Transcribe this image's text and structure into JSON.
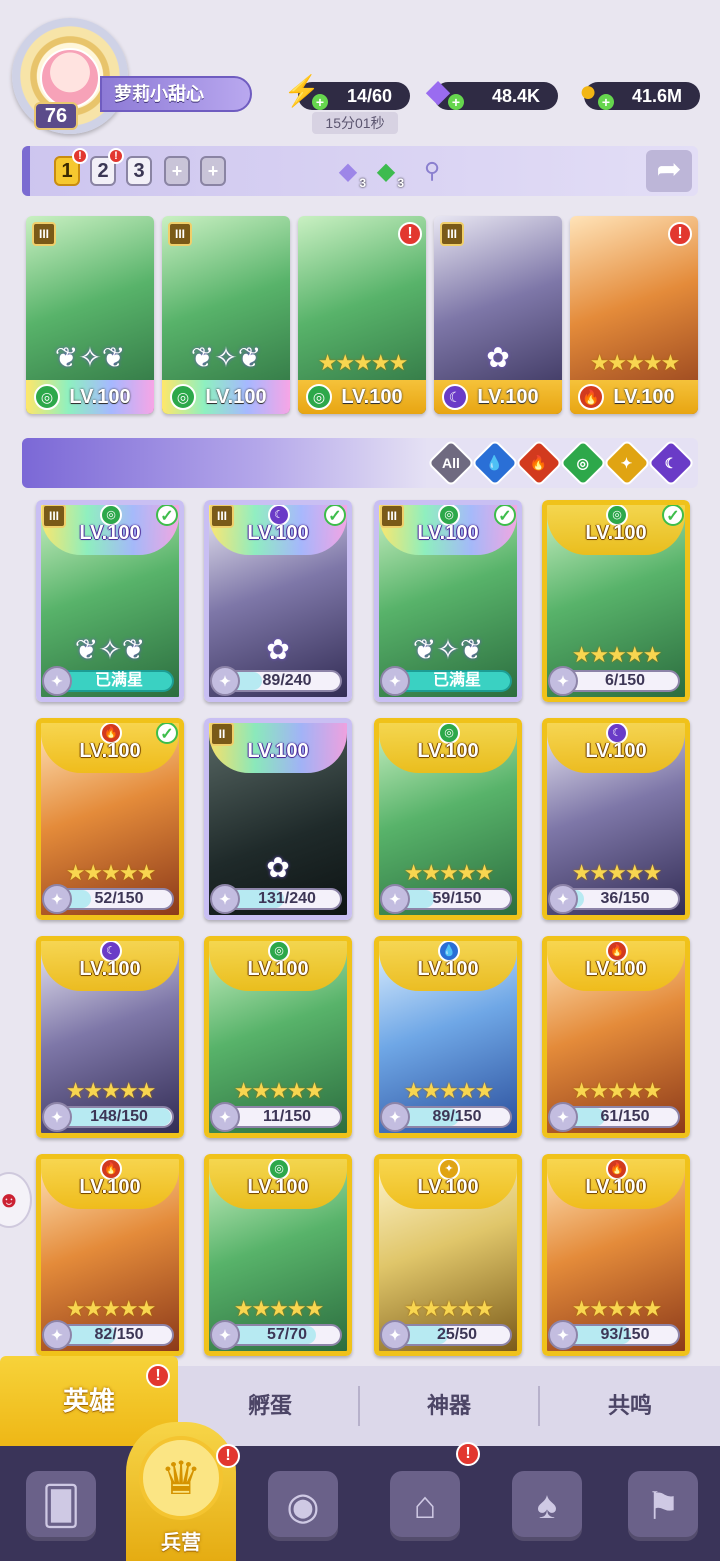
{
  "player": {
    "level": "76",
    "name": "萝莉小甜心"
  },
  "resources": {
    "energy": "14/60",
    "energy_timer": "15分01秒",
    "gems": "48.4K",
    "gold": "41.6M"
  },
  "team_tabs": [
    "1",
    "2",
    "3",
    "+",
    "+"
  ],
  "team_counters": [
    {
      "icon": "purple-crystal-icon",
      "count": "3"
    },
    {
      "icon": "green-crystal-icon",
      "count": "3"
    }
  ],
  "team": [
    {
      "level": "LV.100",
      "element": "wind",
      "rank": "III",
      "type": "wings"
    },
    {
      "level": "LV.100",
      "element": "wind",
      "rank": "III",
      "type": "wings"
    },
    {
      "level": "LV.100",
      "element": "wind",
      "rank": "",
      "type": "stars"
    },
    {
      "level": "LV.100",
      "element": "dark",
      "rank": "III",
      "type": "starflower"
    },
    {
      "level": "LV.100",
      "element": "fire",
      "rank": "",
      "type": "stars"
    }
  ],
  "filters": [
    "All",
    "water",
    "fire",
    "wind",
    "light",
    "dark"
  ],
  "heroes": [
    {
      "level": "LV.100",
      "element": "wind",
      "progress": "已满星",
      "fill": 1.0,
      "full": true,
      "holo": true,
      "rank": "III",
      "checked": true
    },
    {
      "level": "LV.100",
      "element": "dark",
      "progress": "89/240",
      "fill": 0.37,
      "full": false,
      "holo": true,
      "rank": "III",
      "checked": true
    },
    {
      "level": "LV.100",
      "element": "wind",
      "progress": "已满星",
      "fill": 1.0,
      "full": true,
      "holo": true,
      "rank": "III",
      "checked": true
    },
    {
      "level": "LV.100",
      "element": "wind",
      "progress": "6/150",
      "fill": 0.04,
      "full": false,
      "holo": false,
      "rank": "",
      "checked": true
    },
    {
      "level": "LV.100",
      "element": "fire",
      "progress": "52/150",
      "fill": 0.35,
      "full": false,
      "holo": false,
      "rank": "",
      "checked": true
    },
    {
      "level": "LV.100",
      "element": "",
      "progress": "131/240",
      "fill": 0.55,
      "full": false,
      "holo": true,
      "rank": "II",
      "checked": false
    },
    {
      "level": "LV.100",
      "element": "wind",
      "progress": "59/150",
      "fill": 0.39,
      "full": false,
      "holo": false,
      "rank": "",
      "checked": false
    },
    {
      "level": "LV.100",
      "element": "dark",
      "progress": "36/150",
      "fill": 0.24,
      "full": false,
      "holo": false,
      "rank": "",
      "checked": false
    },
    {
      "level": "LV.100",
      "element": "dark",
      "progress": "148/150",
      "fill": 0.99,
      "full": false,
      "holo": false,
      "rank": "",
      "checked": false
    },
    {
      "level": "LV.100",
      "element": "wind",
      "progress": "11/150",
      "fill": 0.07,
      "full": false,
      "holo": false,
      "rank": "",
      "checked": false
    },
    {
      "level": "LV.100",
      "element": "water",
      "progress": "89/150",
      "fill": 0.59,
      "full": false,
      "holo": false,
      "rank": "",
      "checked": false
    },
    {
      "level": "LV.100",
      "element": "fire",
      "progress": "61/150",
      "fill": 0.41,
      "full": false,
      "holo": false,
      "rank": "",
      "checked": false
    },
    {
      "level": "LV.100",
      "element": "fire",
      "progress": "82/150",
      "fill": 0.55,
      "full": false,
      "holo": false,
      "rank": "",
      "checked": false
    },
    {
      "level": "LV.100",
      "element": "wind",
      "progress": "57/70",
      "fill": 0.81,
      "full": false,
      "holo": false,
      "rank": "",
      "checked": false
    },
    {
      "level": "LV.100",
      "element": "light",
      "progress": "25/50",
      "fill": 0.5,
      "full": false,
      "holo": false,
      "rank": "",
      "checked": false
    },
    {
      "level": "LV.100",
      "element": "fire",
      "progress": "93/150",
      "fill": 0.62,
      "full": false,
      "holo": false,
      "rank": "",
      "checked": false
    }
  ],
  "subtabs": [
    "英雄",
    "孵蛋",
    "神器",
    "共鸣"
  ],
  "nav": {
    "active_label": "兵营",
    "items": [
      "cards-icon",
      "barracks-icon",
      "map-book-icon",
      "castle-icon",
      "mushroom-house-icon",
      "guild-banner-icon"
    ]
  },
  "colors": {
    "wind": "#2da84a",
    "fire": "#d23a1e",
    "water": "#2a6fd6",
    "dark": "#6a3bc7",
    "light": "#e0a412",
    "gold_frame": "#f0c21a"
  }
}
